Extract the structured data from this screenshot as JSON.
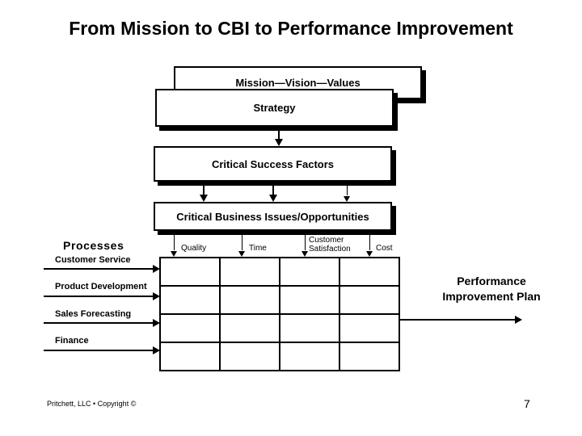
{
  "slide": {
    "title": "From Mission to CBI to Performance Improvement",
    "page_number": "7",
    "footer_credit": "Pritchett, LLC • Copyright ©",
    "background_color": "#ffffff",
    "text_color": "#000000"
  },
  "flow": {
    "boxes": [
      {
        "id": "mission",
        "label": "Mission—Vision—Values"
      },
      {
        "id": "strategy",
        "label": "Strategy"
      },
      {
        "id": "csf",
        "label": "Critical Success Factors"
      },
      {
        "id": "cbi",
        "label": "Critical Business Issues/Opportunities"
      }
    ]
  },
  "matrix": {
    "processes_heading": "Processes",
    "column_headers": [
      {
        "label": "Quality"
      },
      {
        "label": "Time"
      },
      {
        "label": "Customer Satisfaction"
      },
      {
        "label": "Cost"
      }
    ],
    "row_labels": [
      {
        "label": "Customer Service"
      },
      {
        "label": "Product Development"
      },
      {
        "label": "Sales Forecasting"
      },
      {
        "label": "Finance"
      }
    ],
    "rows": 4,
    "columns": 4,
    "cells": [
      [
        "",
        "",
        "",
        ""
      ],
      [
        "",
        "",
        "",
        ""
      ],
      [
        "",
        "",
        "",
        ""
      ],
      [
        "",
        "",
        "",
        ""
      ]
    ]
  },
  "outcome": {
    "line1": "Performance",
    "line2": "Improvement Plan"
  }
}
